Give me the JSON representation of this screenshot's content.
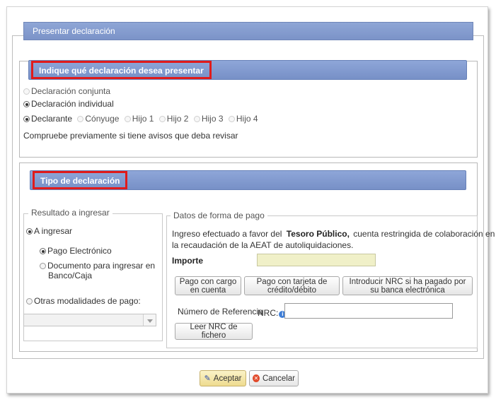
{
  "window": {
    "title": "Presentar declaración"
  },
  "section1": {
    "header": "Indique qué declaración desea presentar",
    "options": [
      {
        "label": "Declaración conjunta",
        "checked": false,
        "enabled": false
      },
      {
        "label": "Declaración individual",
        "checked": true,
        "enabled": true
      }
    ],
    "persons": [
      {
        "label": "Declarante",
        "checked": true
      },
      {
        "label": "Cónyuge",
        "checked": false
      },
      {
        "label": "Hijo 1",
        "checked": false
      },
      {
        "label": "Hijo 2",
        "checked": false
      },
      {
        "label": "Hijo 3",
        "checked": false
      },
      {
        "label": "Hijo 4",
        "checked": false
      }
    ],
    "notice": "Compruebe previamente si tiene avisos que deba revisar"
  },
  "section2": {
    "header": "Tipo de declaración",
    "result": {
      "legend": "Resultado a ingresar",
      "a_ingresar": "A ingresar",
      "pago_electronico": "Pago Electrónico",
      "documento_line1": "Documento para ingresar en",
      "documento_line2": "Banco/Caja",
      "otras": "Otras modalidades de pago:",
      "select_value": ""
    },
    "payment": {
      "legend": "Datos de forma de pago",
      "desc_pre": "Ingreso efectuado a favor del",
      "desc_bold": "Tesoro Público,",
      "desc_post": "cuenta restringida de colaboración en",
      "desc_line2": "la recaudación de la AEAT de autoliquidaciones.",
      "importe_label": "Importe",
      "importe_value": "",
      "btn_cargo_1": "Pago con cargo",
      "btn_cargo_2": "en cuenta",
      "btn_tarjeta_1": "Pago con tarjeta de",
      "btn_tarjeta_2": "crédito/débito",
      "btn_nrc_1": "Introducir NRC si ha pagado por",
      "btn_nrc_2": "su banca electrónica",
      "ref_label": "Número de Referencia",
      "nrc_label": "NRC:",
      "nrc_value": "",
      "btn_leer": "Leer NRC de fichero"
    }
  },
  "footer": {
    "accept": "Aceptar",
    "cancel": "Cancelar"
  },
  "colors": {
    "header_blue": "#7b93c8",
    "highlight_red": "#e01b1b"
  }
}
